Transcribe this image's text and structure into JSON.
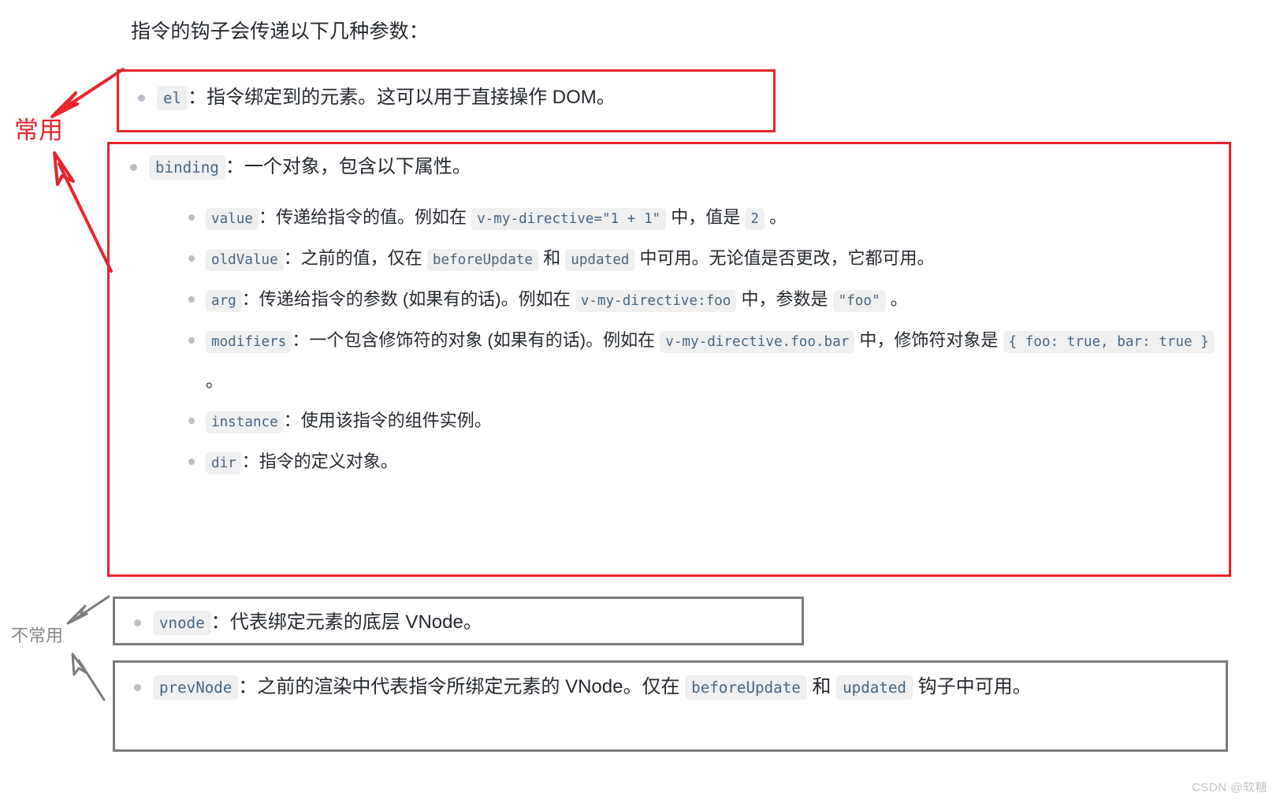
{
  "intro": "指令的钩子会传递以下几种参数：",
  "annotations": {
    "common_label": "常用",
    "uncommon_label": "不常用",
    "common_color": "#e8252c",
    "uncommon_color": "#8a8a8a"
  },
  "boxes": {
    "el": {
      "border_color": "#e8252c"
    },
    "binding": {
      "border_color": "#e8252c"
    },
    "vnode": {
      "border_color": "#7b7b7b"
    },
    "prevNode": {
      "border_color": "#7b7b7b"
    }
  },
  "items": {
    "el": {
      "code": "el",
      "colon": "：",
      "text": "指令绑定到的元素。这可以用于直接操作 DOM。"
    },
    "binding": {
      "code": "binding",
      "colon": "：",
      "text": "一个对象，包含以下属性。",
      "properties": [
        {
          "code": "value",
          "colon": "：",
          "parts": [
            {
              "type": "text",
              "value": "传递给指令的值。例如在 "
            },
            {
              "type": "code",
              "value": "v-my-directive=\"1 + 1\""
            },
            {
              "type": "text",
              "value": " 中，值是 "
            },
            {
              "type": "code",
              "value": "2"
            },
            {
              "type": "text",
              "value": " 。"
            }
          ]
        },
        {
          "code": "oldValue",
          "colon": "：",
          "parts": [
            {
              "type": "text",
              "value": "之前的值，仅在 "
            },
            {
              "type": "code",
              "value": "beforeUpdate"
            },
            {
              "type": "text",
              "value": " 和 "
            },
            {
              "type": "code",
              "value": "updated"
            },
            {
              "type": "text",
              "value": " 中可用。无论值是否更改，它都可用。"
            }
          ]
        },
        {
          "code": "arg",
          "colon": "：",
          "parts": [
            {
              "type": "text",
              "value": "传递给指令的参数 (如果有的话)。例如在 "
            },
            {
              "type": "code",
              "value": "v-my-directive:foo"
            },
            {
              "type": "text",
              "value": " 中，参数是 "
            },
            {
              "type": "code",
              "value": "\"foo\""
            },
            {
              "type": "text",
              "value": " 。"
            }
          ]
        },
        {
          "code": "modifiers",
          "colon": "：",
          "parts": [
            {
              "type": "text",
              "value": "一个包含修饰符的对象 (如果有的话)。例如在 "
            },
            {
              "type": "code",
              "value": "v-my-directive.foo.bar"
            },
            {
              "type": "text",
              "value": " 中，修饰符对象是 "
            },
            {
              "type": "code",
              "value": "{ foo: true, bar: true }"
            },
            {
              "type": "text",
              "value": " 。"
            }
          ]
        },
        {
          "code": "instance",
          "colon": "：",
          "parts": [
            {
              "type": "text",
              "value": "使用该指令的组件实例。"
            }
          ]
        },
        {
          "code": "dir",
          "colon": "：",
          "parts": [
            {
              "type": "text",
              "value": "指令的定义对象。"
            }
          ]
        }
      ]
    },
    "vnode": {
      "code": "vnode",
      "colon": "：",
      "parts": [
        {
          "type": "text",
          "value": "代表绑定元素的底层 VNode。"
        }
      ]
    },
    "prevNode": {
      "code": "prevNode",
      "colon": "：",
      "parts": [
        {
          "type": "text",
          "value": "之前的渲染中代表指令所绑定元素的 VNode。仅在 "
        },
        {
          "type": "code",
          "value": "beforeUpdate"
        },
        {
          "type": "text",
          "value": " 和 "
        },
        {
          "type": "code",
          "value": "updated"
        },
        {
          "type": "text",
          "value": " 钩子中可用。"
        }
      ]
    }
  },
  "watermark": "CSDN @软糖"
}
